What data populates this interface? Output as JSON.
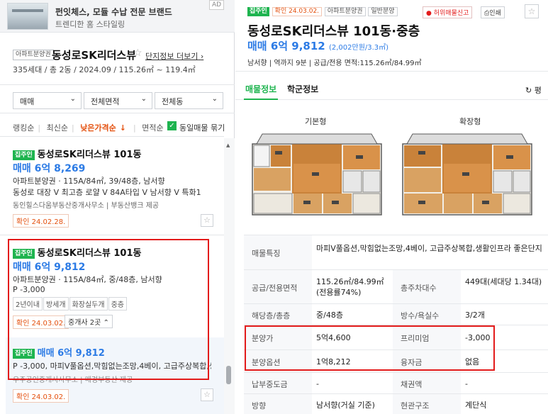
{
  "ad": {
    "title": "펀잇체스, 모듈 수납 전문 브랜드",
    "subtitle": "트렌디한 홈 스타일링",
    "badge": "AD"
  },
  "complex": {
    "type_tag": "아파트분양권",
    "name": "동성로SK리더스뷰",
    "more_label": "단지정보 더보기",
    "info": "335세대 / 총 2동 / 2024.09 / 115.26㎡ ~ 119.4㎡"
  },
  "filters": {
    "trade": "매매",
    "area": "전체면적",
    "dong": "전체동"
  },
  "sort": {
    "options": [
      "랭킹순",
      "최신순",
      "낮은가격순",
      "면적순"
    ],
    "active_suffix": "↓",
    "same_listing_label": "동일매물 묶기"
  },
  "listings": [
    {
      "badge": "집주인",
      "title": "동성로SK리더스뷰 101동",
      "price": "매매 6억 8,269",
      "spec": "아파트분양권 · 115A/84㎡, 39/48층, 남서향",
      "desc": "동성로 대장 V 최고층 로얄 V 84A타입 V 남서향 V 특화1",
      "agents": "동인힐스다움부동산중개사무소 | 부동산뱅크 제공",
      "confirm": "확인 24.02.28."
    },
    {
      "badge": "집주인",
      "title": "동성로SK리더스뷰 101동",
      "price": "매매 6억 9,812",
      "spec": "아파트분양권 · 115A/84㎡, 중/48층, 남서향",
      "premium": "P -3,000",
      "pills": [
        "2년이내",
        "방세개",
        "화장실두개",
        "중층"
      ],
      "confirm": "확인 24.03.02.",
      "broker_count": "중개사 2곳"
    }
  ],
  "sub_listing": {
    "badge": "집주인",
    "price": "매매 6억 9,812",
    "desc": "P -3,000, 마피V풀옵션,막힘없는조망,4베이, 고급주상복합,생활...",
    "agents": "우주공인중개사사무소 | 매경부동산 제공",
    "confirm": "확인 24.03.02."
  },
  "detail": {
    "tags": [
      "집주인",
      "확인 24.03.02.",
      "아파트분양권",
      "일반분양"
    ],
    "report_label": "허위매물신고",
    "print_label": "인쇄",
    "title": "동성로SK리더스뷰 101동·중층",
    "price": "매매 6억 9,812",
    "price_per_area": "(2,002만원/3.3㎡)",
    "info": "남서향 | 역까지 9분 | 공급/전용 면적:115.26㎡/84.99㎡",
    "tabs": [
      "매물정보",
      "학군정보"
    ],
    "refresh_label": "평",
    "floorplans": [
      "기본형",
      "확장형"
    ]
  },
  "specs": {
    "feature_label": "매물특징",
    "feature_value": "마피V풀옵션,막힘없는조망,4베이, 고급주상복합,생활인프라 좋은단지",
    "area_label": "공급/전용면적",
    "area_value": "115.26㎡/84.99㎡(전용률74%)",
    "households_label": "총주차대수",
    "households_value": "449대(세대당 1.34대)",
    "floor_label": "해당층/총층",
    "floor_value": "중/48층",
    "rooms_label": "방수/욕실수",
    "rooms_value": "3/2개",
    "sale_price_label": "분양가",
    "sale_price_value": "5억4,600",
    "premium_label": "프리미엄",
    "premium_value": "-3,000",
    "option_label": "분양옵션",
    "option_value": "1억8,212",
    "loan_label": "융자금",
    "loan_value": "없음",
    "payment_label": "납부중도금",
    "payment_value": "-",
    "bond_label": "채권액",
    "bond_value": "-",
    "direction_label": "방향",
    "direction_value": "남서향(거실 기준)",
    "structure_label": "현관구조",
    "structure_value": "계단식"
  },
  "colors": {
    "accent_green": "#1eb44f",
    "price_blue": "#2c7be5",
    "highlight_red": "#e31b1b",
    "sort_orange": "#e4510f"
  }
}
